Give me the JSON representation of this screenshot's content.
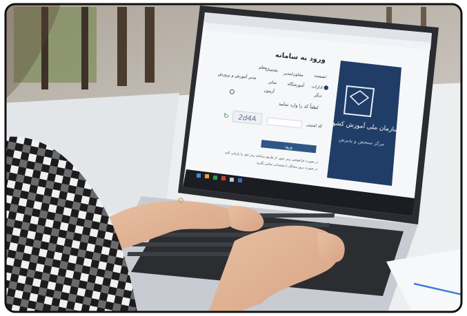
{
  "screen": {
    "page_title": "ورود به سامانه",
    "role_label": "سمت:",
    "roles": [
      "ادارات",
      "معاون/مدیر",
      "پشتیبان",
      "مدیر آموزش و پرورش",
      "معلم",
      "آموزشگاه",
      "سایر",
      "دیگر",
      "آزمون"
    ],
    "instruction": "لطفاً کد را وارد نمایید",
    "captcha_text": "2d4A",
    "code_label": "کد امنیتی",
    "submit_label": "ورود",
    "footer_line_1": "در صورت فراموشی رمز عبور، از طریق سامانه رمز خود را بازیابی کنید",
    "footer_line_2": "در صورت بروز مشکل با پشتیبانی تماس بگیرید",
    "brand_name": "سازمان ملی آموزش کشور",
    "brand_subtitle": "مرکز سنجش و پذیرش"
  },
  "colors": {
    "brand_navy": "#1f3d66",
    "submit_blue": "#2f5687",
    "desk": "#e9ebee",
    "laptop_body": "#c8ccd2"
  },
  "icons": [
    "refresh-icon",
    "emblem-logo-icon",
    "browser-tabs"
  ]
}
